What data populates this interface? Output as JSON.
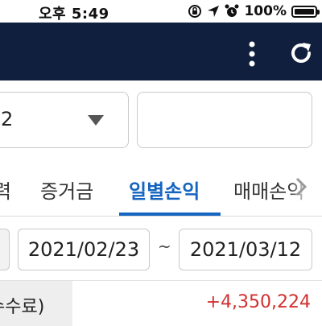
{
  "status_bar": {
    "time": "오후 5:49",
    "battery_percent": "100%",
    "battery_level": 1.0,
    "icons": [
      "screen-rotation-lock-icon",
      "location-arrow-icon",
      "alarm-icon",
      "battery-icon"
    ]
  },
  "app_bar": {
    "background": "#0f1f3d",
    "icons": [
      "more-vertical-icon",
      "refresh-icon"
    ]
  },
  "filters": {
    "account_select_value": "2",
    "text_field_value": ""
  },
  "tabs": {
    "items": [
      "력",
      "증거금",
      "일별손익",
      "매매손익"
    ],
    "active_index": 2,
    "active_color": "#1565c0"
  },
  "date_range": {
    "start": "2021/02/23",
    "separator": "~",
    "end": "2021/03/12"
  },
  "summary": {
    "label": "수수료)",
    "value": "+4,350,224",
    "value_color": "#d32f2f"
  }
}
